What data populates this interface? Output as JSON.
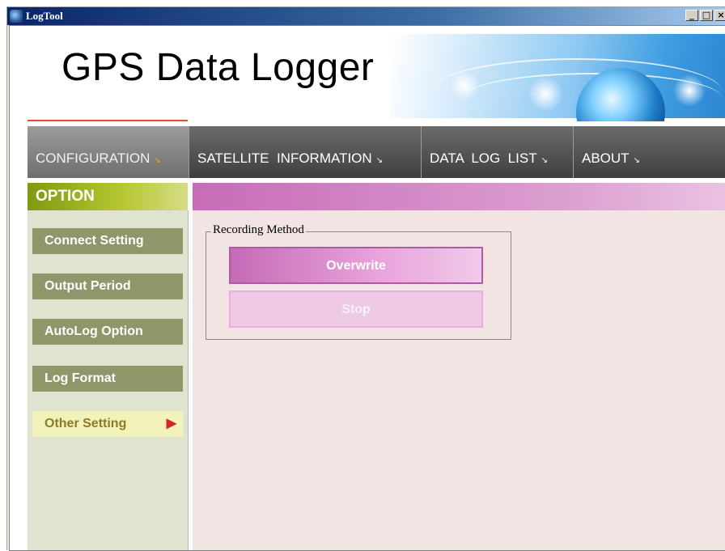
{
  "window": {
    "title": "LogTool",
    "controls": {
      "minimize": "_",
      "maximize": "□",
      "close": "×"
    }
  },
  "header": {
    "app_title": "GPS Data Logger"
  },
  "tabs": [
    {
      "label": "CONFIGURATION",
      "arrow": "↘",
      "active": true
    },
    {
      "label": "SATELLITE  INFORMATION",
      "arrow": "↘",
      "active": false
    },
    {
      "label": "DATA  LOG  LIST",
      "arrow": "↘",
      "active": false
    },
    {
      "label": "ABOUT",
      "arrow": "↘",
      "active": false
    }
  ],
  "sidebar": {
    "heading": "OPTION",
    "items": [
      {
        "label": "Connect Setting",
        "active": false
      },
      {
        "label": "Output Period",
        "active": false
      },
      {
        "label": "AutoLog Option",
        "active": false
      },
      {
        "label": "Log Format",
        "active": false
      },
      {
        "label": "Other Setting",
        "active": true,
        "arrow": "▶"
      }
    ]
  },
  "recording": {
    "group_label": "Recording Method",
    "options": [
      {
        "label": "Overwrite",
        "selected": true
      },
      {
        "label": "Stop",
        "selected": false
      }
    ]
  },
  "colors": {
    "accent_pink": "#c56ab7",
    "sidebar_green": "#8e976a",
    "active_arrow": "#d8222a"
  }
}
